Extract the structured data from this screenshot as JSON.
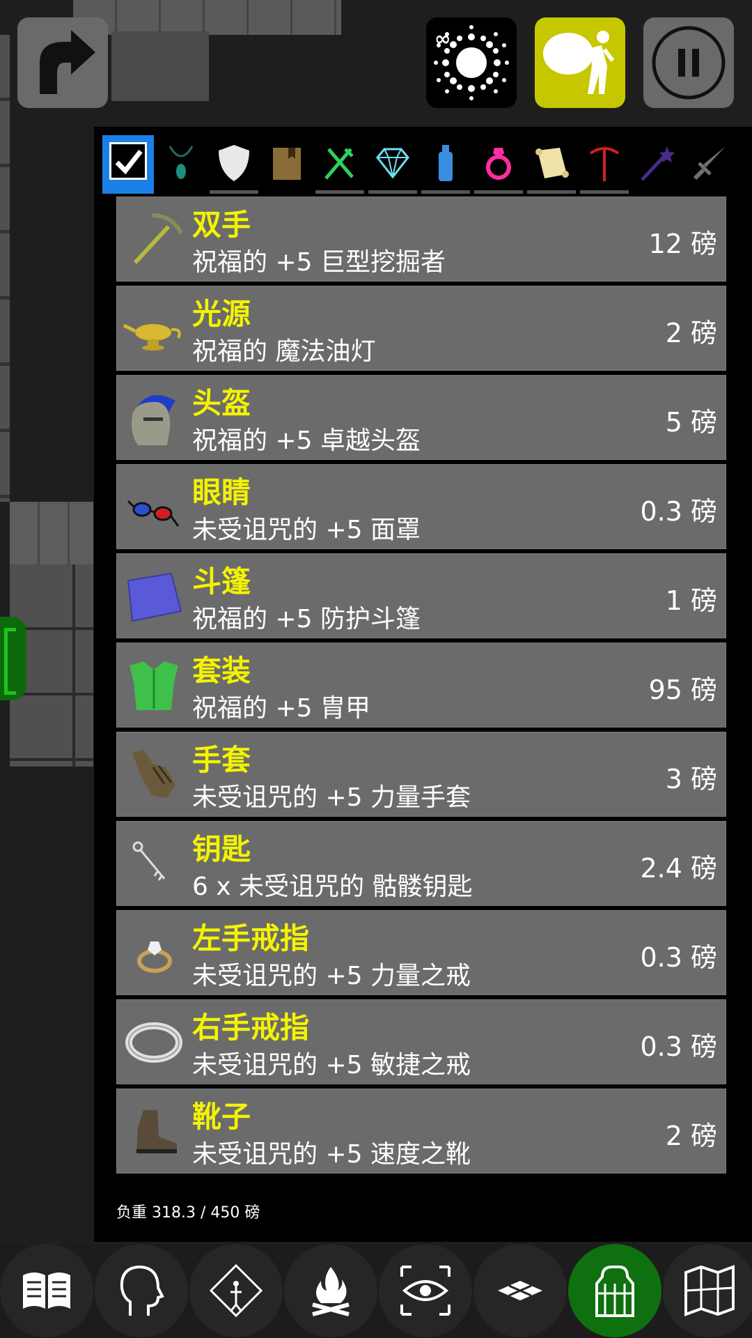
{
  "top_buttons": {
    "redo": "redo-arrow-icon",
    "spell": "infinity-burst-icon",
    "spell_badge": "∞",
    "inventory": "backpack-carrier-icon",
    "pause": "pause-icon"
  },
  "tabs": [
    {
      "name": "all",
      "icon": "checkbox-icon",
      "selected": true
    },
    {
      "name": "amulet",
      "icon": "amulet-icon"
    },
    {
      "name": "armor",
      "icon": "shield-icon"
    },
    {
      "name": "book",
      "icon": "book-icon"
    },
    {
      "name": "food",
      "icon": "fork-knife-icon"
    },
    {
      "name": "gem",
      "icon": "diamond-icon"
    },
    {
      "name": "potion",
      "icon": "potion-icon"
    },
    {
      "name": "ring",
      "icon": "ring-icon"
    },
    {
      "name": "scroll",
      "icon": "scroll-icon"
    },
    {
      "name": "tool",
      "icon": "pickaxe-icon"
    },
    {
      "name": "wand",
      "icon": "wand-icon"
    },
    {
      "name": "weapon",
      "icon": "sword-icon"
    }
  ],
  "items": [
    {
      "slot": "双手",
      "name": "祝福的 +5 巨型挖掘者",
      "weight": "12 磅",
      "icon": "pickaxe-icon"
    },
    {
      "slot": "光源",
      "name": "祝福的 魔法油灯",
      "weight": "2 磅",
      "icon": "oil-lamp-icon"
    },
    {
      "slot": "头盔",
      "name": "祝福的 +5 卓越头盔",
      "weight": "5 磅",
      "icon": "helmet-icon"
    },
    {
      "slot": "眼睛",
      "name": "未受诅咒的 +5 面罩",
      "weight": "0.3 磅",
      "icon": "glasses-icon"
    },
    {
      "slot": "斗篷",
      "name": "祝福的 +5 防护斗篷",
      "weight": "1 磅",
      "icon": "cloak-icon"
    },
    {
      "slot": "套装",
      "name": "祝福的 +5 胄甲",
      "weight": "95 磅",
      "icon": "body-armor-icon"
    },
    {
      "slot": "手套",
      "name": "未受诅咒的 +5 力量手套",
      "weight": "3 磅",
      "icon": "gauntlet-icon"
    },
    {
      "slot": "钥匙",
      "name": "6 x 未受诅咒的 骷髅钥匙",
      "weight": "2.4 磅",
      "icon": "key-icon"
    },
    {
      "slot": "左手戒指",
      "name": "未受诅咒的 +5 力量之戒",
      "weight": "0.3 磅",
      "icon": "gem-ring-icon"
    },
    {
      "slot": "右手戒指",
      "name": "未受诅咒的 +5 敏捷之戒",
      "weight": "0.3 磅",
      "icon": "silver-ring-icon"
    },
    {
      "slot": "靴子",
      "name": "未受诅咒的 +5 速度之靴",
      "weight": "2 磅",
      "icon": "boot-icon"
    }
  ],
  "capacity": "负重 318.3 / 450 磅",
  "bottom_nav": [
    {
      "name": "journal",
      "icon": "open-book-icon"
    },
    {
      "name": "character",
      "icon": "head-profile-icon"
    },
    {
      "name": "skills",
      "icon": "diamond-skill-icon"
    },
    {
      "name": "rest",
      "icon": "campfire-icon"
    },
    {
      "name": "look",
      "icon": "eye-focus-icon"
    },
    {
      "name": "floor",
      "icon": "floor-grid-icon"
    },
    {
      "name": "inventory",
      "icon": "backpack-icon",
      "active": true
    },
    {
      "name": "map",
      "icon": "map-icon"
    }
  ],
  "colors": {
    "slot_text": "#f3f300",
    "inventory_button": "#c7c700",
    "active_nav": "#0f700f",
    "selected_tab": "#1a7fe6"
  }
}
